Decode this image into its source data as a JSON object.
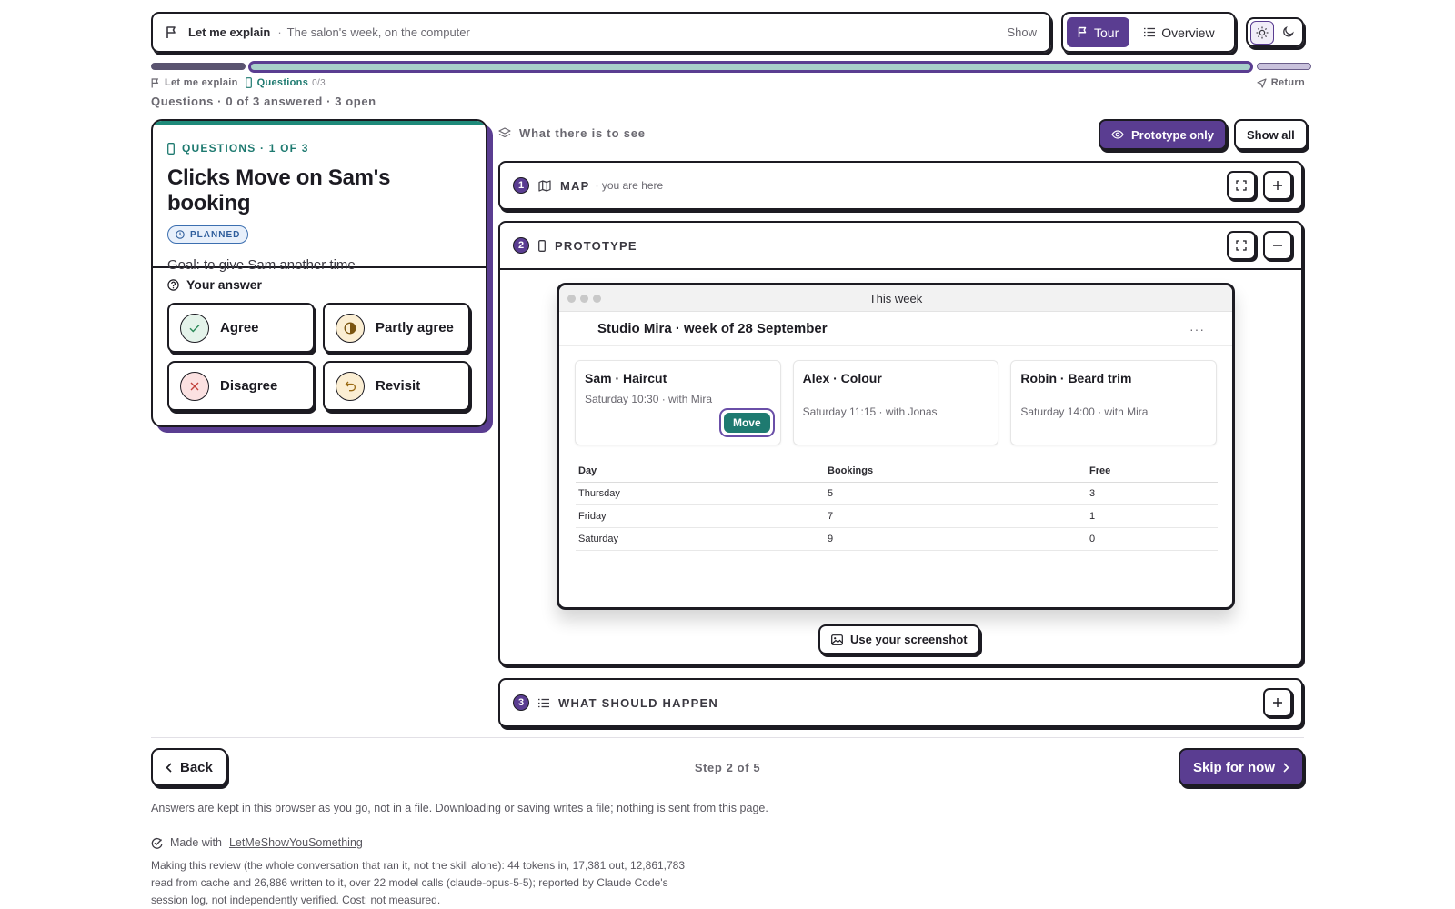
{
  "topbar": {
    "explain_title": "Let me explain",
    "explain_separator": "·",
    "explain_subtitle": "The salon's week, on the computer",
    "show_label": "Show",
    "tour_label": "Tour",
    "overview_label": "Overview",
    "theme_selected": "light"
  },
  "progress": {
    "steps_total": 5,
    "current_step": 2,
    "crumb_explain": "Let me explain",
    "crumb_questions": "Questions",
    "crumb_questions_count": "0/3",
    "return_label": "Return"
  },
  "status_line": "Questions · 0 of 3 answered · 3 open",
  "question": {
    "eyebrow": "QUESTIONS · 1 OF 3",
    "title": "Clicks Move on Sam's booking",
    "badge": "PLANNED",
    "goal": "Goal: to give Sam another time",
    "answer_heading": "Your answer",
    "answers": {
      "agree": "Agree",
      "partly": "Partly agree",
      "disagree": "Disagree",
      "revisit": "Revisit"
    }
  },
  "section": {
    "heading": "What there is to see",
    "filter_prototype": "Prototype only",
    "filter_all": "Show all"
  },
  "panels": {
    "map": {
      "number": "1",
      "title": "MAP",
      "subtitle": "· you are here"
    },
    "prototype": {
      "number": "2",
      "title": "PROTOTYPE"
    },
    "should": {
      "number": "3",
      "title": "WHAT SHOULD HAPPEN"
    }
  },
  "prototype": {
    "window_title": "This week",
    "studio": "Studio Mira · week of 28 September",
    "more": "···",
    "bookings": [
      {
        "name": "Sam · Haircut",
        "meta": "Saturday 10:30 · with Mira",
        "action": "Move"
      },
      {
        "name": "Alex · Colour",
        "meta": "Saturday 11:15 · with Jonas"
      },
      {
        "name": "Robin · Beard trim",
        "meta": "Saturday 14:00 · with Mira"
      }
    ],
    "table": {
      "headers": {
        "day": "Day",
        "bookings": "Bookings",
        "free": "Free"
      },
      "rows": [
        {
          "day": "Thursday",
          "bookings": "5",
          "free": "3"
        },
        {
          "day": "Friday",
          "bookings": "7",
          "free": "1"
        },
        {
          "day": "Saturday",
          "bookings": "9",
          "free": "0"
        }
      ]
    },
    "screenshot_button": "Use your screenshot"
  },
  "footer": {
    "back_label": "Back",
    "step_label": "Step 2 of 5",
    "skip_label": "Skip for now",
    "note": "Answers are kept in this browser as you go, not in a file. Downloading or saving writes a file; nothing is sent from this page.",
    "made_with": "Made with",
    "made_link": "LetMeShowYouSomething",
    "cost_note": "Making this review (the whole conversation that ran it, not the skill alone): 44 tokens in, 17,381 out, 12,861,783 read from cache and 26,886 written to it, over 22 model calls (claude-opus-5-5); reported by Claude Code's session log, not independently verified. Cost: not measured."
  },
  "colors": {
    "accent": "#5a3d91",
    "teal": "#1e7a70",
    "ink": "#1c1b22"
  }
}
